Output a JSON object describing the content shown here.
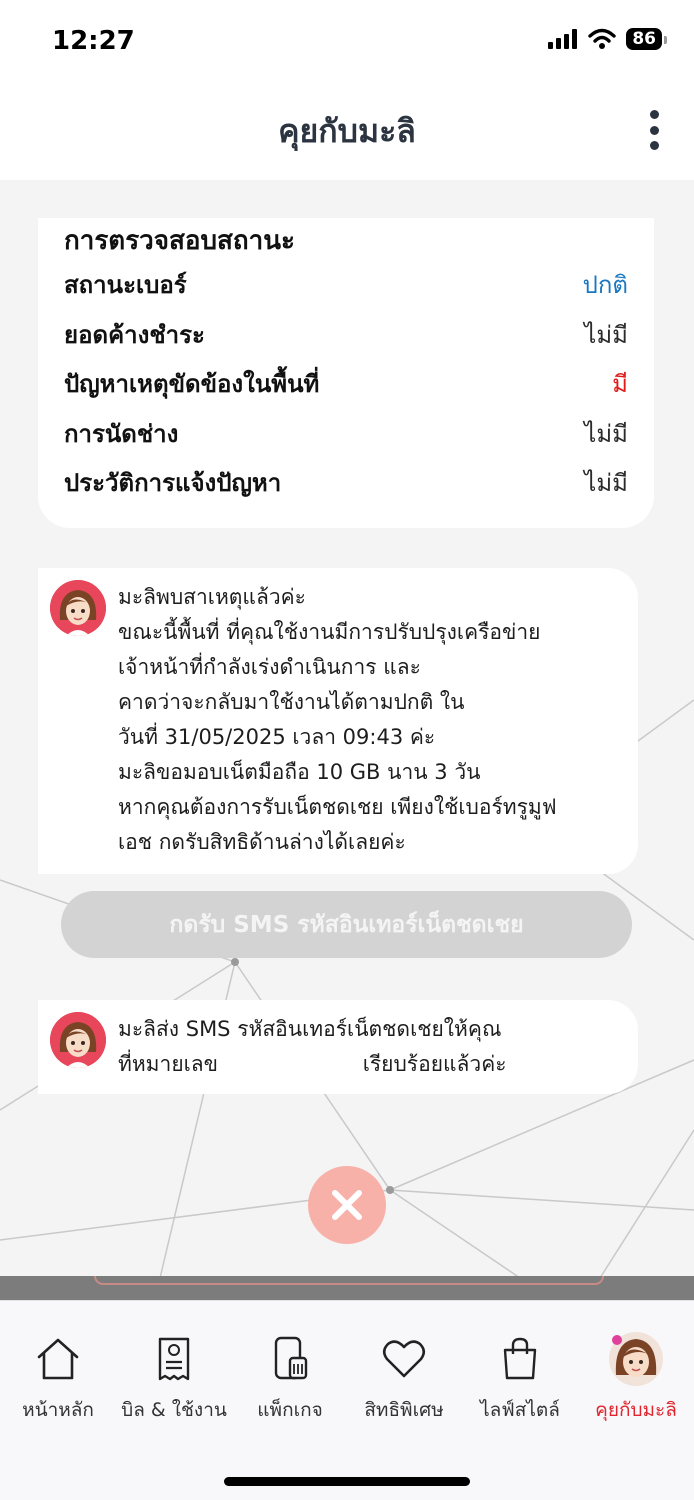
{
  "status_bar": {
    "time": "12:27",
    "battery": "86"
  },
  "header": {
    "title": "คุยกับมะลิ"
  },
  "status_card": {
    "title": "การตรวจสอบสถานะ",
    "rows": [
      {
        "label": "สถานะเบอร์",
        "value": "ปกติ",
        "color": "#1a78c2"
      },
      {
        "label": "ยอดค้างชำระ",
        "value": "ไม่มี",
        "color": "#2b2b2b"
      },
      {
        "label": "ปัญหาเหตุขัดข้องในพื้นที่",
        "value": "มี",
        "color": "#e01b1b"
      },
      {
        "label": "การนัดช่าง",
        "value": "ไม่มี",
        "color": "#2b2b2b"
      },
      {
        "label": "ประวัติการแจ้งปัญหา",
        "value": "ไม่มี",
        "color": "#2b2b2b"
      }
    ]
  },
  "messages": [
    {
      "lines": [
        "มะลิพบสาเหตุแล้วค่ะ",
        "ขณะนี้พื้นที่ ที่คุณใช้งานมีการปรับปรุงเครือข่าย",
        "เจ้าหน้าที่กำลังเร่งดำเนินการ และ",
        "คาดว่าจะกลับมาใช้งานได้ตามปกติ ใน",
        "วันที่ 31/05/2025 เวลา 09:43 ค่ะ",
        "มะลิขอมอบเน็ตมือถือ 10 GB นาน 3 วัน",
        "หากคุณต้องการรับเน็ตชดเชย เพียงใช้เบอร์ทรูมูฟ",
        "เอช กดรับสิทธิด้านล่างได้เลยค่ะ"
      ]
    },
    {
      "line1": "มะลิส่ง SMS รหัสอินเทอร์เน็ตชดเชยให้คุณ",
      "line2_prefix": "ที่หมายเลข",
      "line2_suffix": " เรียบร้อยแล้วค่ะ"
    }
  ],
  "claim_button": {
    "label": "กดรับ SMS รหัสอินเทอร์เน็ตชดเชย"
  },
  "nav": {
    "items": [
      {
        "label": "หน้าหลัก",
        "icon": "home-icon"
      },
      {
        "label": "บิล & ใช้งาน",
        "icon": "bill-icon"
      },
      {
        "label": "แพ็กเกจ",
        "icon": "package-icon"
      },
      {
        "label": "สิทธิพิเศษ",
        "icon": "heart-icon"
      },
      {
        "label": "ไลฟ์สไตล์",
        "icon": "shopping-bag-icon"
      },
      {
        "label": "คุยกับมะลิ",
        "icon": "mali-avatar-icon",
        "active": true
      }
    ]
  },
  "colors": {
    "accent": "#e0252e",
    "status_blue": "#1a78c2",
    "status_red": "#e01b1b",
    "close_button": "#f7b1a8"
  }
}
